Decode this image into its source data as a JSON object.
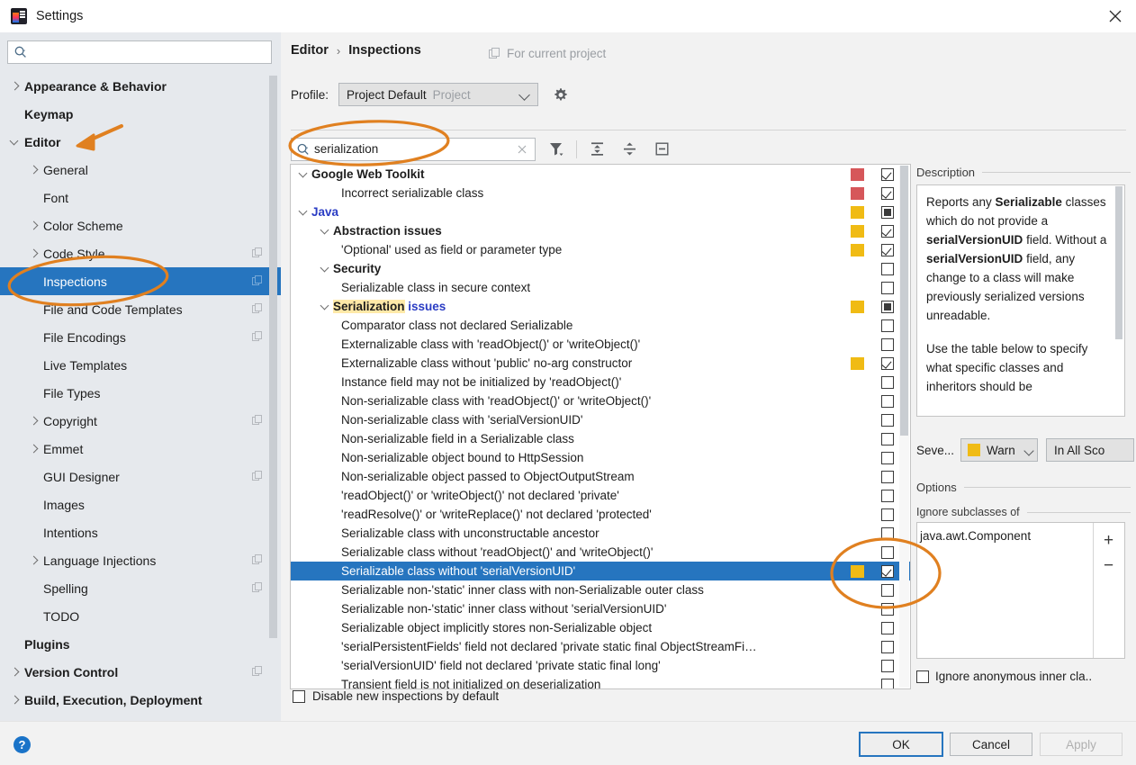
{
  "window": {
    "title": "Settings",
    "app_icon": "intellij-idea-icon",
    "close_icon": "close-icon"
  },
  "sidebar": {
    "search": {
      "value": "",
      "placeholder": "",
      "icon": "search-icon"
    },
    "items": [
      {
        "label": "Appearance & Behavior",
        "indent": 0,
        "bold": true,
        "arrow": "closed",
        "copy": false,
        "selected": false
      },
      {
        "label": "Keymap",
        "indent": 0,
        "bold": true,
        "arrow": "none",
        "copy": false,
        "selected": false
      },
      {
        "label": "Editor",
        "indent": 0,
        "bold": true,
        "arrow": "open",
        "copy": false,
        "selected": false
      },
      {
        "label": "General",
        "indent": 1,
        "bold": false,
        "arrow": "closed",
        "copy": false,
        "selected": false
      },
      {
        "label": "Font",
        "indent": 1,
        "bold": false,
        "arrow": "none",
        "copy": false,
        "selected": false
      },
      {
        "label": "Color Scheme",
        "indent": 1,
        "bold": false,
        "arrow": "closed",
        "copy": false,
        "selected": false
      },
      {
        "label": "Code Style",
        "indent": 1,
        "bold": false,
        "arrow": "closed",
        "copy": true,
        "selected": false
      },
      {
        "label": "Inspections",
        "indent": 1,
        "bold": false,
        "arrow": "none",
        "copy": true,
        "selected": true
      },
      {
        "label": "File and Code Templates",
        "indent": 1,
        "bold": false,
        "arrow": "none",
        "copy": true,
        "selected": false
      },
      {
        "label": "File Encodings",
        "indent": 1,
        "bold": false,
        "arrow": "none",
        "copy": true,
        "selected": false
      },
      {
        "label": "Live Templates",
        "indent": 1,
        "bold": false,
        "arrow": "none",
        "copy": false,
        "selected": false
      },
      {
        "label": "File Types",
        "indent": 1,
        "bold": false,
        "arrow": "none",
        "copy": false,
        "selected": false
      },
      {
        "label": "Copyright",
        "indent": 1,
        "bold": false,
        "arrow": "closed",
        "copy": true,
        "selected": false
      },
      {
        "label": "Emmet",
        "indent": 1,
        "bold": false,
        "arrow": "closed",
        "copy": false,
        "selected": false
      },
      {
        "label": "GUI Designer",
        "indent": 1,
        "bold": false,
        "arrow": "none",
        "copy": true,
        "selected": false
      },
      {
        "label": "Images",
        "indent": 1,
        "bold": false,
        "arrow": "none",
        "copy": false,
        "selected": false
      },
      {
        "label": "Intentions",
        "indent": 1,
        "bold": false,
        "arrow": "none",
        "copy": false,
        "selected": false
      },
      {
        "label": "Language Injections",
        "indent": 1,
        "bold": false,
        "arrow": "closed",
        "copy": true,
        "selected": false
      },
      {
        "label": "Spelling",
        "indent": 1,
        "bold": false,
        "arrow": "none",
        "copy": true,
        "selected": false
      },
      {
        "label": "TODO",
        "indent": 1,
        "bold": false,
        "arrow": "none",
        "copy": false,
        "selected": false
      },
      {
        "label": "Plugins",
        "indent": 0,
        "bold": true,
        "arrow": "none",
        "copy": false,
        "selected": false
      },
      {
        "label": "Version Control",
        "indent": 0,
        "bold": true,
        "arrow": "closed",
        "copy": true,
        "selected": false
      },
      {
        "label": "Build, Execution, Deployment",
        "indent": 0,
        "bold": true,
        "arrow": "closed",
        "copy": false,
        "selected": false
      }
    ]
  },
  "header": {
    "breadcrumb": {
      "parent": "Editor",
      "separator": "›",
      "current": "Inspections"
    },
    "for_current_project": "For current project",
    "for_current_project_icon": "copy-icon",
    "profile_label": "Profile:",
    "profile_value": "Project Default",
    "profile_scope": "Project",
    "gear_icon": "gear-icon",
    "chevron_icon": "chevron-down-icon"
  },
  "toolbar": {
    "search_value": "serialization",
    "search_placeholder": "",
    "search_icon": "search-icon",
    "clear_icon": "clear-x-icon",
    "filter_icon": "filter-funnel-icon",
    "expand_all_icon": "expand-all-icon",
    "collapse_all_icon": "collapse-all-icon",
    "toggle_icon": "minimize-box-icon"
  },
  "inspections": {
    "rows": [
      {
        "label": "Google Web Toolkit",
        "indent": 0,
        "arrow": true,
        "style": "group",
        "severity": "red",
        "check": "checked",
        "selected": false
      },
      {
        "label": "Incorrect serializable class",
        "indent": 2,
        "arrow": false,
        "style": "leaf",
        "severity": "red",
        "check": "checked",
        "selected": false
      },
      {
        "label": "Java",
        "indent": 0,
        "arrow": true,
        "style": "javatop",
        "severity": "yellow",
        "check": "partial",
        "selected": false
      },
      {
        "label": "Abstraction issues",
        "indent": 1,
        "arrow": true,
        "style": "group",
        "severity": "yellow",
        "check": "checked",
        "selected": false
      },
      {
        "label": "'Optional' used as field or parameter type",
        "indent": 2,
        "arrow": false,
        "style": "leaf",
        "severity": "yellow",
        "check": "checked",
        "selected": false
      },
      {
        "label": "Security",
        "indent": 1,
        "arrow": true,
        "style": "group",
        "severity": "none",
        "check": "unchecked",
        "selected": false
      },
      {
        "label": "Serializable class in secure context",
        "indent": 2,
        "arrow": false,
        "style": "leaf",
        "severity": "none",
        "check": "unchecked",
        "selected": false
      },
      {
        "label": "Serialization issues",
        "indent": 1,
        "arrow": true,
        "style": "group-highlight",
        "highlight": "Serialization",
        "rest": " issues",
        "severity": "yellow",
        "check": "partial",
        "selected": false
      },
      {
        "label": "Comparator class not declared Serializable",
        "indent": 2,
        "arrow": false,
        "style": "leaf",
        "severity": "none",
        "check": "unchecked",
        "selected": false
      },
      {
        "label": "Externalizable class with 'readObject()' or 'writeObject()'",
        "indent": 2,
        "arrow": false,
        "style": "leaf",
        "severity": "none",
        "check": "unchecked",
        "selected": false
      },
      {
        "label": "Externalizable class without 'public' no-arg constructor",
        "indent": 2,
        "arrow": false,
        "style": "leaf",
        "severity": "yellow",
        "check": "checked",
        "selected": false
      },
      {
        "label": "Instance field may not be initialized by 'readObject()'",
        "indent": 2,
        "arrow": false,
        "style": "leaf",
        "severity": "none",
        "check": "unchecked",
        "selected": false
      },
      {
        "label": "Non-serializable class with 'readObject()' or 'writeObject()'",
        "indent": 2,
        "arrow": false,
        "style": "leaf",
        "severity": "none",
        "check": "unchecked",
        "selected": false
      },
      {
        "label": "Non-serializable class with 'serialVersionUID'",
        "indent": 2,
        "arrow": false,
        "style": "leaf",
        "severity": "none",
        "check": "unchecked",
        "selected": false
      },
      {
        "label": "Non-serializable field in a Serializable class",
        "indent": 2,
        "arrow": false,
        "style": "leaf",
        "severity": "none",
        "check": "unchecked",
        "selected": false
      },
      {
        "label": "Non-serializable object bound to HttpSession",
        "indent": 2,
        "arrow": false,
        "style": "leaf",
        "severity": "none",
        "check": "unchecked",
        "selected": false
      },
      {
        "label": "Non-serializable object passed to ObjectOutputStream",
        "indent": 2,
        "arrow": false,
        "style": "leaf",
        "severity": "none",
        "check": "unchecked",
        "selected": false
      },
      {
        "label": "'readObject()' or 'writeObject()' not declared 'private'",
        "indent": 2,
        "arrow": false,
        "style": "leaf",
        "severity": "none",
        "check": "unchecked",
        "selected": false
      },
      {
        "label": "'readResolve()' or 'writeReplace()' not declared 'protected'",
        "indent": 2,
        "arrow": false,
        "style": "leaf",
        "severity": "none",
        "check": "unchecked",
        "selected": false
      },
      {
        "label": "Serializable class with unconstructable ancestor",
        "indent": 2,
        "arrow": false,
        "style": "leaf",
        "severity": "none",
        "check": "unchecked",
        "selected": false
      },
      {
        "label": "Serializable class without 'readObject()' and 'writeObject()'",
        "indent": 2,
        "arrow": false,
        "style": "leaf",
        "severity": "none",
        "check": "unchecked",
        "selected": false
      },
      {
        "label": "Serializable class without 'serialVersionUID'",
        "indent": 2,
        "arrow": false,
        "style": "leaf",
        "severity": "yellow",
        "check": "checked",
        "selected": true
      },
      {
        "label": "Serializable non-'static' inner class with non-Serializable outer class",
        "indent": 2,
        "arrow": false,
        "style": "leaf",
        "severity": "none",
        "check": "unchecked",
        "selected": false
      },
      {
        "label": "Serializable non-'static' inner class without 'serialVersionUID'",
        "indent": 2,
        "arrow": false,
        "style": "leaf",
        "severity": "none",
        "check": "unchecked",
        "selected": false
      },
      {
        "label": "Serializable object implicitly stores non-Serializable object",
        "indent": 2,
        "arrow": false,
        "style": "leaf",
        "severity": "none",
        "check": "unchecked",
        "selected": false
      },
      {
        "label": "'serialPersistentFields' field not declared 'private static final ObjectStreamFi…",
        "indent": 2,
        "arrow": false,
        "style": "leaf",
        "severity": "none",
        "check": "unchecked",
        "selected": false
      },
      {
        "label": "'serialVersionUID' field not declared 'private static final long'",
        "indent": 2,
        "arrow": false,
        "style": "leaf",
        "severity": "none",
        "check": "unchecked",
        "selected": false
      },
      {
        "label": "Transient field is not initialized on deserialization",
        "indent": 2,
        "arrow": false,
        "style": "leaf",
        "severity": "none",
        "check": "unchecked",
        "selected": false
      }
    ],
    "disable_new_label": "Disable new inspections by default",
    "disable_new_checked": false
  },
  "description": {
    "title": "Description",
    "paragraph1_parts": [
      {
        "t": "Reports any ",
        "b": false
      },
      {
        "t": "Serializable",
        "b": true
      },
      {
        "t": " classes which do not provide a ",
        "b": false
      },
      {
        "t": "serialVersionUID",
        "b": true
      },
      {
        "t": " field. Without a ",
        "b": false
      },
      {
        "t": "serialVersionUID",
        "b": true
      },
      {
        "t": " field, any change to a class will make previously serialized versions unreadable.",
        "b": false
      }
    ],
    "paragraph2": "Use the table below to specify what specific classes and inheritors should be"
  },
  "severity": {
    "label": "Seve...",
    "value": "Warn",
    "color": "#f0bb14",
    "scope_value": "In All Sco"
  },
  "options": {
    "title": "Options",
    "ignore_subclasses_title": "Ignore subclasses of",
    "list_items": [
      "java.awt.Component"
    ],
    "add_label": "+",
    "remove_label": "−",
    "anonymous_label": "Ignore anonymous inner cla..",
    "anonymous_checked": false
  },
  "footer": {
    "help_icon": "help-icon",
    "help_glyph": "?",
    "ok": "OK",
    "cancel": "Cancel",
    "apply": "Apply"
  },
  "colors": {
    "accent_blue": "#2675bf",
    "annotation_orange": "#e08020",
    "severity_error": "#d6575a",
    "severity_warning": "#f0bb14",
    "highlight_yellow": "#ffe9a8"
  }
}
